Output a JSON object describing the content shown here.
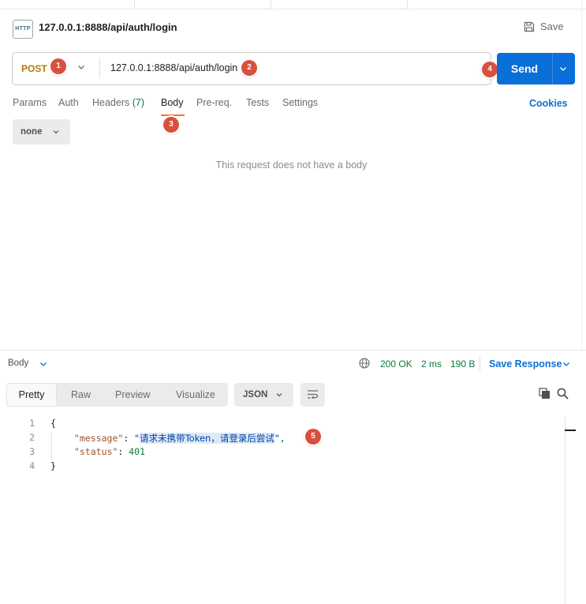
{
  "request": {
    "icon_text": "HTTP",
    "title": "127.0.0.1:8888/api/auth/login",
    "save_label": "Save",
    "method": "POST",
    "url": "127.0.0.1:8888/api/auth/login",
    "send_label": "Send"
  },
  "badges": [
    "1",
    "2",
    "3",
    "4",
    "5"
  ],
  "tabs": {
    "params": "Params",
    "auth": "Auth",
    "headers": "Headers",
    "headers_count": "(7)",
    "body": "Body",
    "prereq": "Pre-req.",
    "tests": "Tests",
    "settings": "Settings",
    "cookies": "Cookies"
  },
  "body_mode": "none",
  "empty_body_text": "This request does not have a body",
  "response": {
    "section_label": "Body",
    "status": "200 OK",
    "time": "2 ms",
    "size": "190 B",
    "save_response": "Save Response",
    "view_tabs": [
      "Pretty",
      "Raw",
      "Preview",
      "Visualize"
    ],
    "format": "JSON"
  },
  "code": {
    "line_numbers": [
      "1",
      "2",
      "3",
      "4"
    ],
    "open_brace": "{",
    "close_brace": "}",
    "message_key": "\"message\"",
    "message_quote_open": "\"",
    "message_value": "请求未携带Token，请登录后尝试",
    "message_quote_close": "\",",
    "status_key": "\"status\"",
    "status_value": "401"
  },
  "colors": {
    "accent": "#0a6fd8",
    "method": "#ad7a03",
    "status_ok": "#0b7a3d",
    "badge": "#d9503f",
    "active_tab_underline": "#ff6c37"
  }
}
